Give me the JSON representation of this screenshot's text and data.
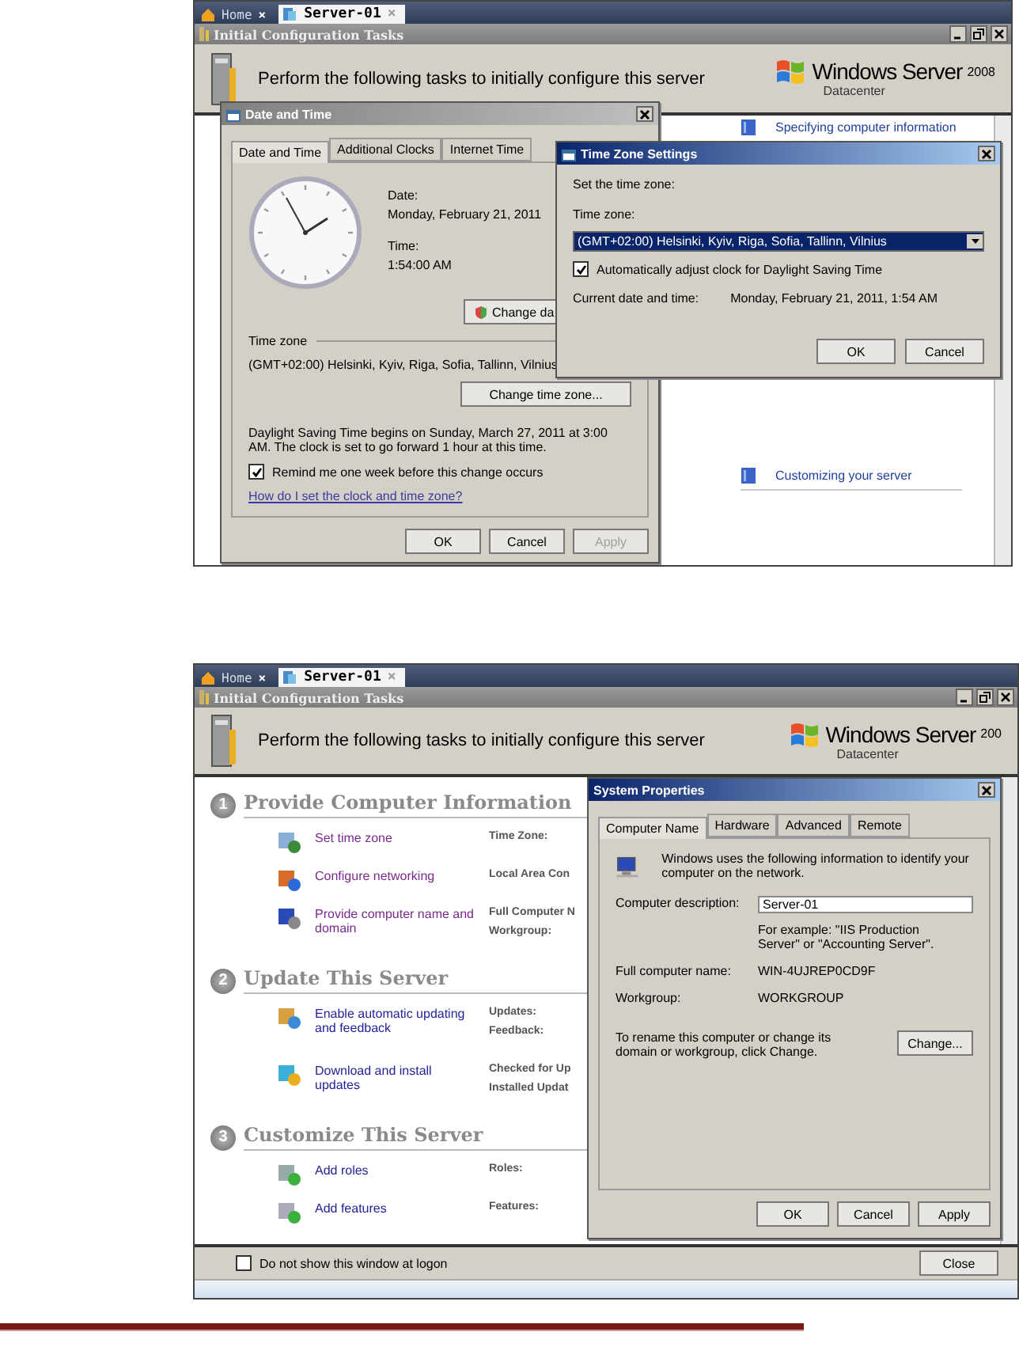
{
  "first_screenshot": {
    "tabs": [
      {
        "label": "Home",
        "close": "×",
        "selected": false
      },
      {
        "label": "Server-01",
        "close": "×",
        "selected": true
      }
    ],
    "window_title": "Initial Configuration Tasks",
    "header": {
      "text": "Perform the following tasks to initially configure this server",
      "logo_brand": "Windows Server",
      "logo_version": "2008",
      "logo_edition": "Datacenter"
    },
    "help_links": [
      "Specifying computer information",
      "Customizing your server"
    ],
    "date_time_dialog": {
      "title": "Date and Time",
      "tabs": [
        {
          "label": "Date and Time",
          "selected": true
        },
        {
          "label": "Additional Clocks",
          "selected": false
        },
        {
          "label": "Internet Time",
          "selected": false
        }
      ],
      "date_label": "Date:",
      "date": "Monday, February 21, 2011",
      "time_label": "Time:",
      "time": "1:54:00 AM",
      "change_date_button": "Change da",
      "time_zone_group": "Time zone",
      "time_zone": "(GMT+02:00) Helsinki, Kyiv, Riga, Sofia, Tallinn, Vilnius",
      "change_time_zone_button": "Change time zone...",
      "dst_notice": "Daylight Saving Time begins on Sunday, March 27, 2011 at 3:00 AM. The clock is set to go forward 1 hour at this time.",
      "reminder": {
        "label": "Remind me one week before this change occurs",
        "checked": true
      },
      "help_link": "How do I set the clock and time zone?",
      "buttons": [
        {
          "label": "OK",
          "disabled": false
        },
        {
          "label": "Cancel",
          "disabled": false
        },
        {
          "label": "Apply",
          "disabled": true
        }
      ]
    },
    "time_zone_dialog": {
      "title": "Time Zone Settings",
      "prompt": "Set the time zone:",
      "time_zone_label": "Time zone:",
      "time_zone": "(GMT+02:00) Helsinki, Kyiv, Riga, Sofia, Tallinn, Vilnius",
      "auto_dst": {
        "label": "Automatically adjust clock for Daylight Saving Time",
        "checked": true
      },
      "current_label": "Current date and time:",
      "current_value": "Monday, February 21, 2011, 1:54 AM",
      "buttons": [
        "OK",
        "Cancel"
      ]
    }
  },
  "second_screenshot": {
    "tabs": [
      {
        "label": "Home",
        "close": "×",
        "selected": false
      },
      {
        "label": "Server-01",
        "close": "×",
        "selected": true
      }
    ],
    "window_title": "Initial Configuration Tasks",
    "header": {
      "text": "Perform the following tasks to initially configure this server",
      "logo_brand": "Windows Server",
      "logo_version": "200",
      "logo_edition": "Datacenter"
    },
    "sections": [
      {
        "number": "1",
        "title": "Provide Computer Information",
        "tasks": [
          {
            "link": "Set time zone",
            "visited": true,
            "details": [
              "Time Zone:"
            ]
          },
          {
            "link": "Configure networking",
            "visited": true,
            "details": [
              "Local Area Con"
            ]
          },
          {
            "link": "Provide computer name and domain",
            "visited": true,
            "details": [
              "Full Computer N",
              "Workgroup:"
            ]
          }
        ]
      },
      {
        "number": "2",
        "title": "Update This Server",
        "tasks": [
          {
            "link": "Enable automatic updating and feedback",
            "visited": false,
            "details": [
              "Updates:",
              "Feedback:"
            ]
          },
          {
            "link": "Download and install updates",
            "visited": false,
            "details": [
              "Checked for Up",
              "Installed Updat"
            ]
          }
        ]
      },
      {
        "number": "3",
        "title": "Customize This Server",
        "tasks": [
          {
            "link": "Add roles",
            "visited": false,
            "details": [
              "Roles:"
            ]
          },
          {
            "link": "Add features",
            "visited": false,
            "details": [
              "Features:"
            ]
          }
        ]
      }
    ],
    "logon_option": {
      "label": "Do not show this window at logon",
      "checked": false
    },
    "close_button": "Close",
    "system_properties_dialog": {
      "title": "System Properties",
      "tabs": [
        {
          "label": "Computer Name",
          "selected": true
        },
        {
          "label": "Hardware",
          "selected": false
        },
        {
          "label": "Advanced",
          "selected": false
        },
        {
          "label": "Remote",
          "selected": false
        }
      ],
      "intro": "Windows uses the following information to identify your computer on the network.",
      "description_label": "Computer description:",
      "description_value": "Server-01",
      "example": "For example: \"IIS Production Server\" or \"Accounting Server\".",
      "full_name_label": "Full computer name:",
      "full_name": "WIN-4UJREP0CD9F",
      "workgroup_label": "Workgroup:",
      "workgroup": "WORKGROUP",
      "rename_text": "To rename this computer or change its domain or workgroup, click Change.",
      "change_button": "Change...",
      "buttons": [
        {
          "label": "OK",
          "disabled": false
        },
        {
          "label": "Cancel",
          "disabled": false
        },
        {
          "label": "Apply",
          "disabled": false
        }
      ]
    }
  }
}
